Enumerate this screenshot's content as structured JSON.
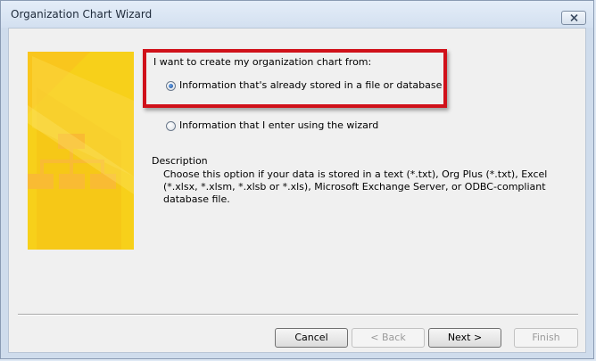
{
  "window": {
    "title": "Organization Chart Wizard"
  },
  "main": {
    "prompt": "I want to create my organization chart from:",
    "options": [
      {
        "label": "Information that's already stored in a file or database",
        "selected": true
      },
      {
        "label": "Information that I enter using the wizard",
        "selected": false
      }
    ],
    "description_heading": "Description",
    "description_text": "Choose this option if your data is stored in a text (*.txt), Org Plus (*.txt), Excel (*.xlsx, *.xlsm, *.xlsb or *.xls), Microsoft Exchange Server, or ODBC-compliant database file."
  },
  "buttons": {
    "cancel": "Cancel",
    "back": "< Back",
    "next": "Next >",
    "finish": "Finish"
  },
  "colors": {
    "highlight": "#d0111a",
    "art_background": "#f7d01a",
    "art_motif": "#f9bb33"
  },
  "icons": {
    "close": "close-icon",
    "art": "org-chart-illustration"
  }
}
